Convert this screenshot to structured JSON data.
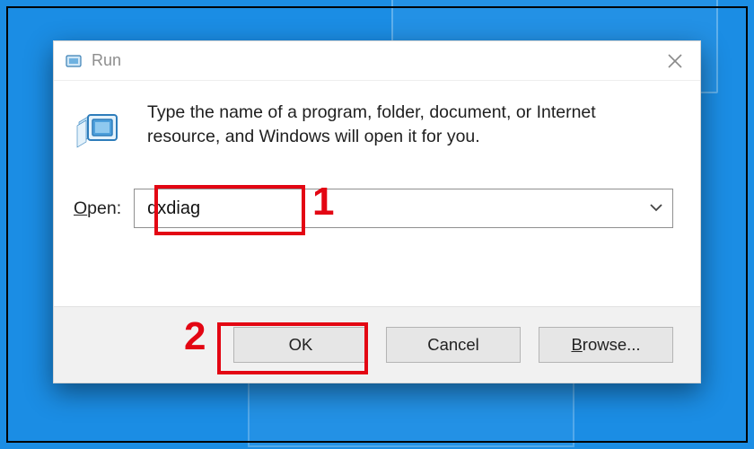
{
  "dialog": {
    "title": "Run",
    "instruction": "Type the name of a program, folder, document, or Internet resource, and Windows will open it for you.",
    "open_label_prefix": "O",
    "open_label_rest": "pen:",
    "input_value": "dxdiag",
    "buttons": {
      "ok": "OK",
      "cancel": "Cancel",
      "browse_prefix": "B",
      "browse_rest": "rowse..."
    }
  },
  "annotations": {
    "step1": "1",
    "step2": "2",
    "highlight_color": "#e30613"
  }
}
